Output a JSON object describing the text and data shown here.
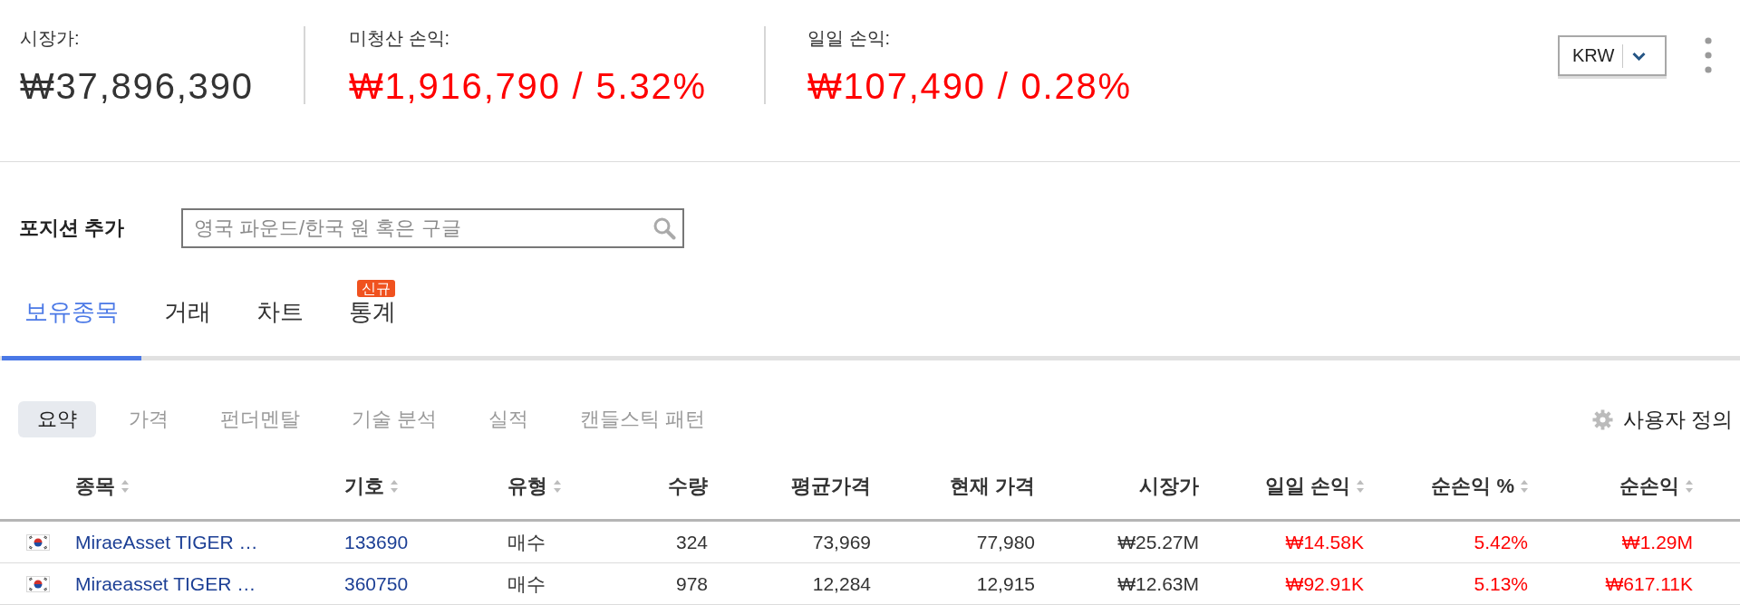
{
  "summary": [
    {
      "label": "시장가:",
      "value": "₩37,896,390",
      "color": "#333333"
    },
    {
      "label": "미청산 손익:",
      "value": "₩1,916,790 / 5.32%",
      "color": "#ff0000"
    },
    {
      "label": "일일 손익:",
      "value": "₩107,490 / 0.28%",
      "color": "#ff0000"
    }
  ],
  "currency_select": {
    "value": "KRW"
  },
  "add_position": {
    "label": "포지션 추가",
    "search": {
      "placeholder": "영국 파운드/한국 원 혹은 구글"
    }
  },
  "tabs": [
    {
      "label": "보유종목",
      "selected": true
    },
    {
      "label": "거래",
      "selected": false
    },
    {
      "label": "차트",
      "selected": false
    },
    {
      "label": "통계",
      "selected": false,
      "badge": "신규"
    }
  ],
  "view_tabs": [
    {
      "label": "요약",
      "selected": true
    },
    {
      "label": "가격",
      "selected": false
    },
    {
      "label": "펀더멘탈",
      "selected": false
    },
    {
      "label": "기술 분석",
      "selected": false
    },
    {
      "label": "실적",
      "selected": false
    },
    {
      "label": "캔들스틱 패턴",
      "selected": false
    }
  ],
  "customize": {
    "label": "사용자 정의"
  },
  "table": {
    "columns": [
      {
        "label": "종목",
        "sortable": true
      },
      {
        "label": "기호",
        "sortable": true
      },
      {
        "label": "유형",
        "sortable": true
      },
      {
        "label": "수량",
        "sortable": false
      },
      {
        "label": "평균가격",
        "sortable": false
      },
      {
        "label": "현재 가격",
        "sortable": false
      },
      {
        "label": "시장가",
        "sortable": false
      },
      {
        "label": "일일 손익",
        "sortable": true
      },
      {
        "label": "순손익 %",
        "sortable": true
      },
      {
        "label": "순손익",
        "sortable": true
      }
    ],
    "rows": [
      {
        "name": "MiraeAsset TIGER …",
        "symbol": "133690",
        "type": "매수",
        "quantity": "324",
        "avg_price": "73,969",
        "price": "77,980",
        "market_value": "₩25.27M",
        "daily_pl": "₩14.58K",
        "net_pl_pct": "5.42%",
        "net_pl": "₩1.29M",
        "color": "#ff0000"
      },
      {
        "name": "Miraeasset TIGER …",
        "symbol": "360750",
        "type": "매수",
        "quantity": "978",
        "avg_price": "12,284",
        "price": "12,915",
        "market_value": "₩12.63M",
        "daily_pl": "₩92.91K",
        "net_pl_pct": "5.13%",
        "net_pl": "₩617.11K",
        "color": "#ff0000"
      }
    ]
  }
}
